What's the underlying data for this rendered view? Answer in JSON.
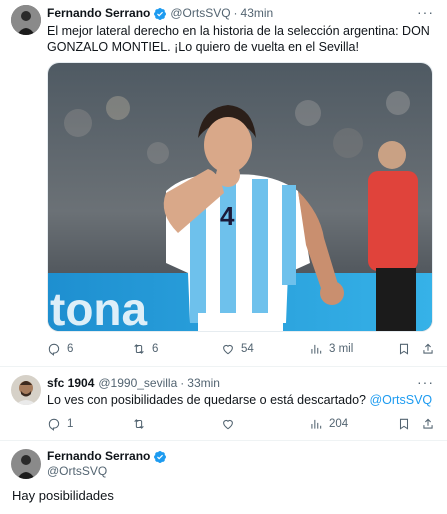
{
  "tweet1": {
    "name": "Fernando Serrano",
    "handle": "@OrtsSVQ",
    "time": "43min",
    "dot": "·",
    "more": "···",
    "text_line1": "El mejor lateral derecho en la historia de la selección argentina: DON",
    "text_line2": "GONZALO MONTIEL. ¡Lo quiero de vuelta en el Sevilla!",
    "replies": "6",
    "retweets": "6",
    "likes": "54",
    "views": "3 mil"
  },
  "tweet2": {
    "name": "sfc 1904",
    "handle": "@1990_sevilla",
    "time": "33min",
    "dot": "·",
    "more": "···",
    "text": "Lo ves con posibilidades de quedarse o está descartado? ",
    "mention": "@OrtsSVQ",
    "replies": "1",
    "retweets": "",
    "likes": "",
    "views": "204"
  },
  "tweet3": {
    "name": "Fernando Serrano",
    "handle": "@OrtsSVQ",
    "text": "Hay posibilidades"
  },
  "media": {
    "jersey_number": "4",
    "banner_text": "tona"
  },
  "colors": {
    "accent": "#1d9bf0",
    "muted": "#536471",
    "text": "#0f1419"
  }
}
